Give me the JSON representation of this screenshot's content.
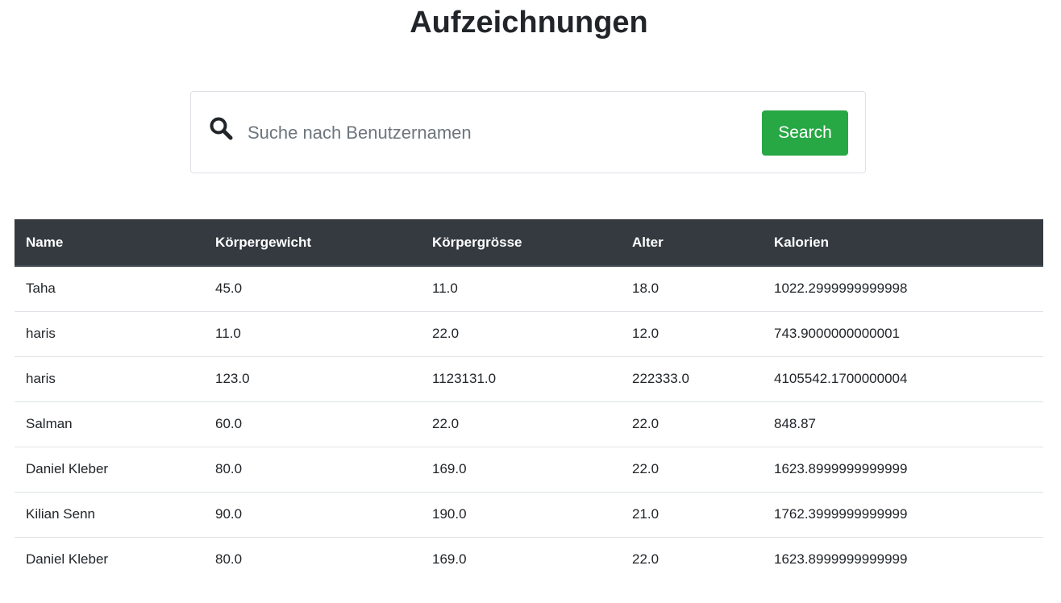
{
  "page": {
    "title": "Aufzeichnungen"
  },
  "search": {
    "icon": "search-icon",
    "placeholder": "Suche nach Benutzernamen",
    "value": "",
    "button_label": "Search",
    "button_color": "#28a745"
  },
  "table": {
    "header_color": "#343a40",
    "columns": [
      "Name",
      "Körpergewicht",
      "Körpergrösse",
      "Alter",
      "Kalorien"
    ],
    "rows": [
      [
        "Taha",
        "45.0",
        "11.0",
        "18.0",
        "1022.2999999999998"
      ],
      [
        "haris",
        "11.0",
        "22.0",
        "12.0",
        "743.9000000000001"
      ],
      [
        "haris",
        "123.0",
        "1123131.0",
        "222333.0",
        "4105542.1700000004"
      ],
      [
        "Salman",
        "60.0",
        "22.0",
        "22.0",
        "848.87"
      ],
      [
        "Daniel Kleber",
        "80.0",
        "169.0",
        "22.0",
        "1623.8999999999999"
      ],
      [
        "Kilian Senn",
        "90.0",
        "190.0",
        "21.0",
        "1762.3999999999999"
      ],
      [
        "Daniel Kleber",
        "80.0",
        "169.0",
        "22.0",
        "1623.8999999999999"
      ]
    ]
  }
}
